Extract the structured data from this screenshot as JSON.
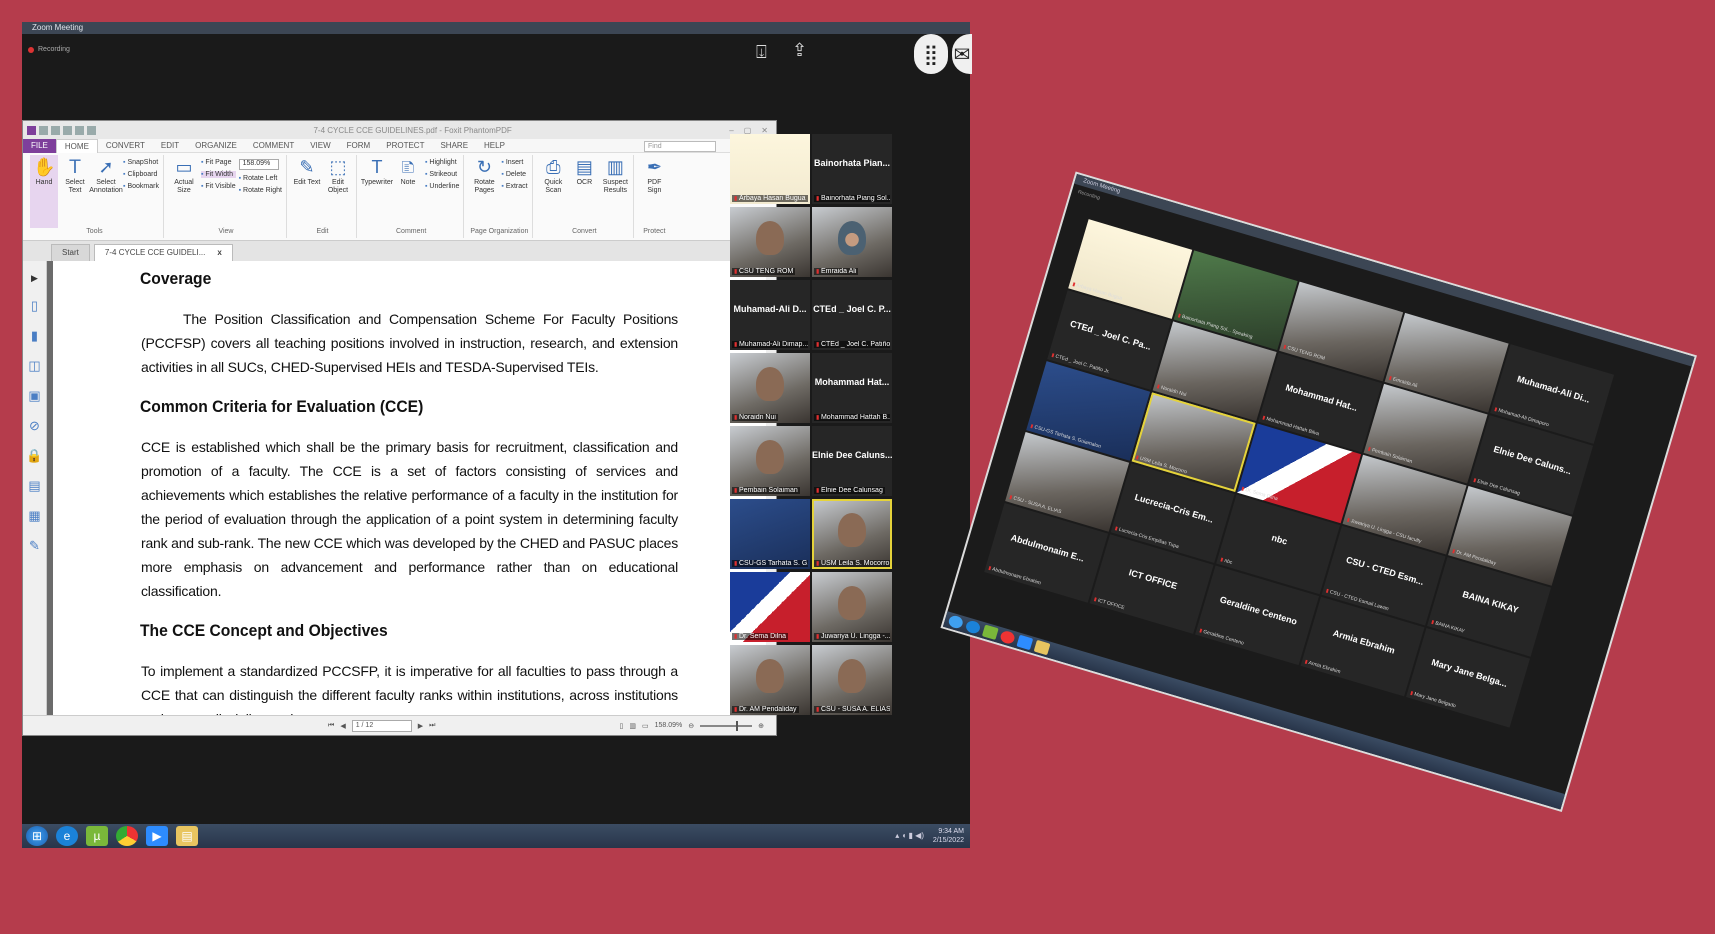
{
  "main_window": {
    "title": "Zoom Meeting",
    "recording_label": "Recording"
  },
  "pdf": {
    "title": "7-4 CYCLE CCE GUIDELINES.pdf - Foxit PhantomPDF",
    "menu": [
      "FILE",
      "HOME",
      "CONVERT",
      "EDIT",
      "ORGANIZE",
      "COMMENT",
      "VIEW",
      "FORM",
      "PROTECT",
      "SHARE",
      "HELP"
    ],
    "find_placeholder": "Find",
    "ribbon": {
      "tools": {
        "label": "Tools",
        "hand": "Hand",
        "select_text": "Select Text",
        "select_annotation": "Select Annotation",
        "snapshot": "SnapShot",
        "clipboard": "Clipboard",
        "bookmark": "Bookmark"
      },
      "view": {
        "label": "View",
        "actual_size": "Actual Size",
        "fit_page": "Fit Page",
        "fit_width": "Fit Width",
        "fit_visible": "Fit Visible",
        "zoom": "158.09%",
        "rotate_left": "Rotate Left",
        "rotate_right": "Rotate Right"
      },
      "edit": {
        "label": "Edit",
        "edit_text": "Edit Text",
        "edit_object": "Edit Object"
      },
      "comment": {
        "label": "Comment",
        "typewriter": "Typewriter",
        "note": "Note",
        "highlight": "Highlight",
        "strikeout": "Strikeout",
        "underline": "Underline"
      },
      "page_org": {
        "label": "Page Organization",
        "rotate_pages": "Rotate Pages",
        "insert": "Insert",
        "delete": "Delete",
        "extract": "Extract"
      },
      "convert": {
        "label": "Convert",
        "quick_scan": "Quick Scan",
        "ocr": "OCR",
        "suspect_results": "Suspect Results"
      },
      "protect": {
        "label": "Protect",
        "pdf_sign": "PDF Sign"
      }
    },
    "tabs": {
      "start": "Start",
      "doc": "7-4 CYCLE CCE GUIDELI...",
      "close": "x"
    },
    "content": {
      "h1": "Coverage",
      "p1": "The Position Classification and Compensation Scheme For Faculty Positions (PCCFSP) covers all teaching positions involved in instruction, research, and extension activities in all SUCs, CHED-Supervised HEIs and TESDA-Supervised TEIs.",
      "h2": "Common Criteria for Evaluation (CCE)",
      "p2": "CCE is established which shall be the primary basis for recruitment, classification and promotion of a faculty. The CCE is a set of factors consisting of services and achievements which establishes the relative performance of a faculty in the institution for the period of evaluation through the application of a point system in determining faculty rank and sub-rank. The new CCE which was developed by the CHED and PASUC places more emphasis on advancement and performance rather than on educational classification.",
      "h3": "The CCE Concept and Objectives",
      "p3": "To implement a standardized PCCSFP, it is imperative for all faculties to pass through a CCE that can distinguish the different faculty ranks within institutions, across institutions and across discipline and"
    },
    "status": {
      "page": "1 / 12",
      "zoom": "158.09%"
    }
  },
  "participants": [
    {
      "big": "",
      "label": "Arbaya Hasan Bugua"
    },
    {
      "big": "Bainorhata Pian...",
      "label": "Bainorhata Piang Sol..."
    },
    {
      "big": "",
      "label": "CSU TENG ROM"
    },
    {
      "big": "",
      "label": "Emraida Ali"
    },
    {
      "big": "Muhamad-Ali D...",
      "label": "Muhamad-Ali Dimap..."
    },
    {
      "big": "CTEd _ Joel C. P...",
      "label": "CTEd _ Joel C. Patiño"
    },
    {
      "big": "",
      "label": "Noraidn Nui"
    },
    {
      "big": "Mohammad Hat...",
      "label": "Mohammad Hattah B..."
    },
    {
      "big": "",
      "label": "Pembain Solaiman"
    },
    {
      "big": "Elnie Dee Caluns...",
      "label": "Elnie Dee Calunsag"
    },
    {
      "big": "",
      "label": "CSU-GS Tarhata S. G..."
    },
    {
      "big": "",
      "label": "USM Leila S. Mocorro"
    },
    {
      "big": "",
      "label": "Dr. Sema Dilna"
    },
    {
      "big": "",
      "label": "Juwariya U. Lingga -..."
    },
    {
      "big": "",
      "label": "Dr. AM Pendaliday"
    },
    {
      "big": "",
      "label": "CSU - SUSA A. ELIAS"
    }
  ],
  "taskbar": {
    "time": "9:34 AM",
    "date": "2/15/2022"
  },
  "side_window": {
    "title": "Zoom Meeting",
    "recording_label": "Recording",
    "tiles": [
      {
        "big": "",
        "label": "Arbaya Hasan Bugua"
      },
      {
        "big": "",
        "label": "Bainorhata Piang Sol... Speaking"
      },
      {
        "big": "",
        "label": "CSU TENG ROM"
      },
      {
        "big": "",
        "label": "Emraida Ali"
      },
      {
        "big": "Muhamad-Ali Di...",
        "label": "Muhamad-Ali Dimaporo"
      },
      {
        "big": "CTEd _ Joel C. Pa...",
        "label": "CTEd _ Joel C. Patiño Jr."
      },
      {
        "big": "",
        "label": "Noraidn Nui"
      },
      {
        "big": "Mohammad Hat...",
        "label": "Mohammad Hattah Bilva"
      },
      {
        "big": "",
        "label": "Pembain Solaiman"
      },
      {
        "big": "Elnie Dee Caluns...",
        "label": "Elnie Dee Calunsag"
      },
      {
        "big": "",
        "label": "CSU-GS Tarhata S. Guiamalon"
      },
      {
        "big": "",
        "label": "USM Leila S. Mocorro"
      },
      {
        "big": "",
        "label": "Dr. Sema Dilna"
      },
      {
        "big": "",
        "label": "Juwariya U. Lingga - CSU faculty"
      },
      {
        "big": "",
        "label": "Dr. AM Pendaliday"
      },
      {
        "big": "",
        "label": "CSU - SUSA A. ELIAS"
      },
      {
        "big": "Lucrecia-Cris Em...",
        "label": "Lucrecia-Cris Empilias Tupa"
      },
      {
        "big": "nbc",
        "label": "nbc"
      },
      {
        "big": "CSU - CTED Esm...",
        "label": "CSU - CTED Esmail Lawan"
      },
      {
        "big": "BAINA KIKAY",
        "label": "BAINA KIKAY"
      },
      {
        "big": "Abdulmonaim E...",
        "label": "Abdulmonaim Ebrahim"
      },
      {
        "big": "ICT OFFICE",
        "label": "ICT OFFICE"
      },
      {
        "big": "Geraldine Centeno",
        "label": "Geraldine Centeno"
      },
      {
        "big": "Armia Ebrahim",
        "label": "Armia Ebrahim"
      },
      {
        "big": "Mary Jane Belga...",
        "label": "Mary Jane Belgado"
      }
    ]
  }
}
